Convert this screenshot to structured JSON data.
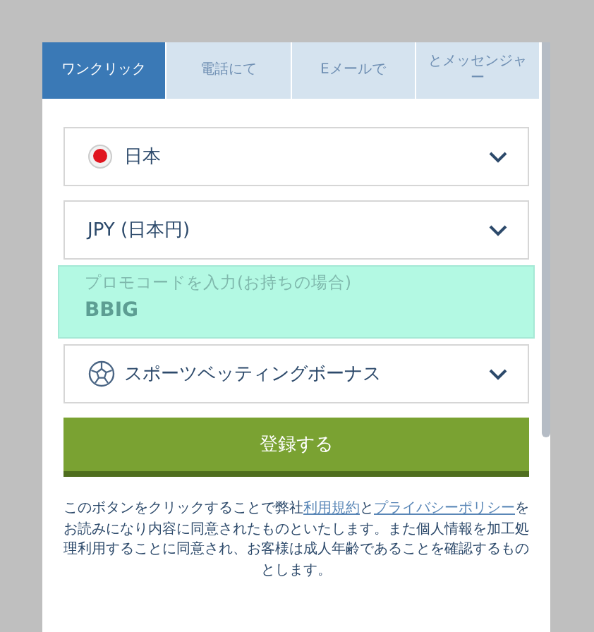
{
  "tabs": [
    {
      "label": "ワンクリック",
      "selected": true
    },
    {
      "label": "電話にて",
      "selected": false
    },
    {
      "label": "Eメールで",
      "selected": false
    },
    {
      "label": "とメッセンジャー",
      "selected": false
    }
  ],
  "fields": [
    {
      "kind": "country",
      "value": "日本"
    },
    {
      "kind": "currency",
      "value": "JPY (日本円)"
    },
    {
      "kind": "promo",
      "placeholder": "プロモコードを入力(お持ちの場合)",
      "value": "BBIG",
      "highlighted": true
    },
    {
      "kind": "bonus",
      "value": "スポーツベッティングボーナス"
    }
  ],
  "submit_button": "登録する",
  "terms": [
    {
      "kind": "text",
      "text": "このボタンをクリックすることで弊社"
    },
    {
      "kind": "link",
      "text": "利用規約"
    },
    {
      "kind": "text",
      "text": "と"
    },
    {
      "kind": "link",
      "text": "プライバシーポリシー"
    },
    {
      "kind": "text",
      "text": "をお読みになり内容に同意されたものといたします。また個人情報を加工処理利用することに同意され、お客様は成人年齢であることを確認するものとします。"
    }
  ]
}
